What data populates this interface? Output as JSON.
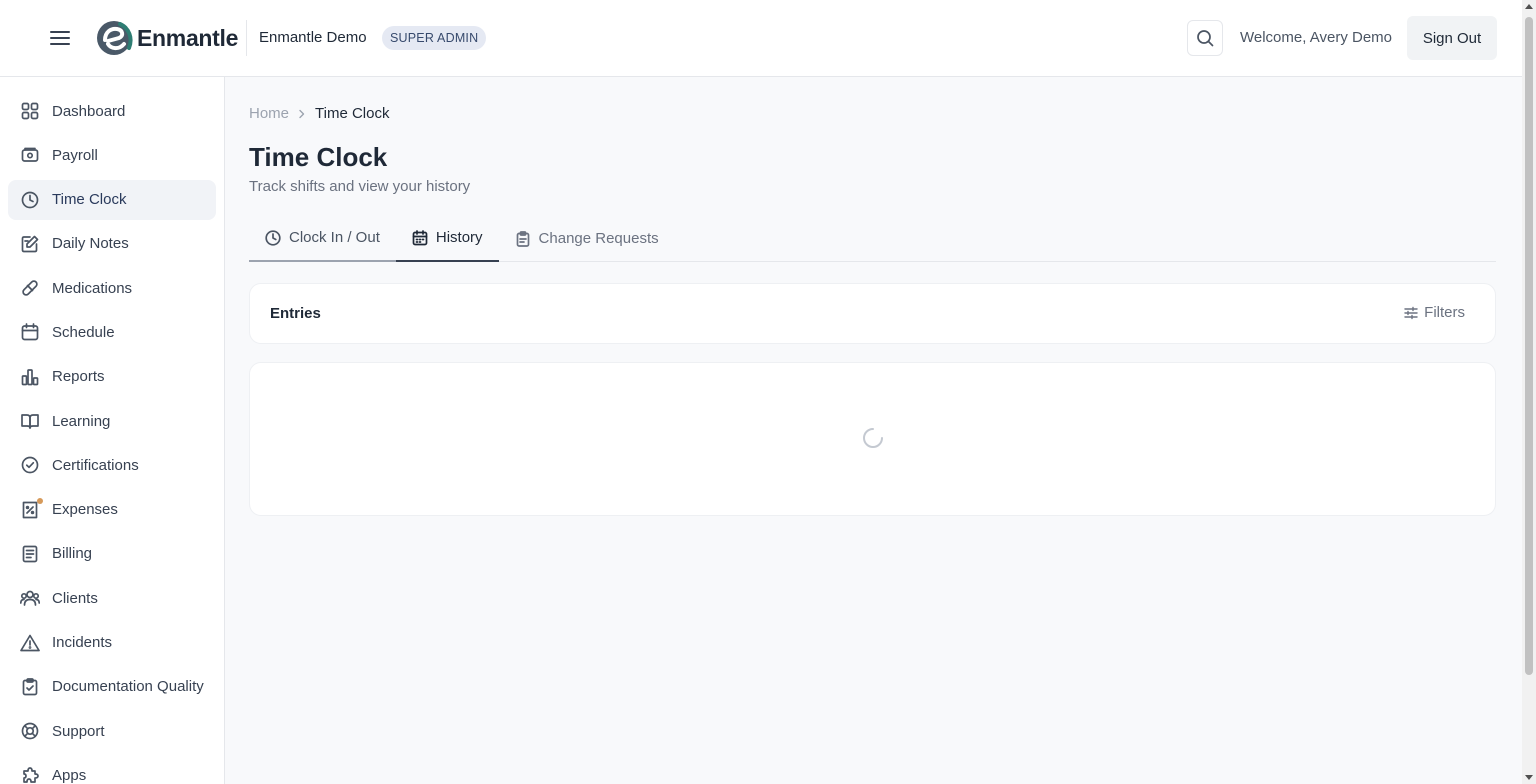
{
  "header": {
    "logo_text": "Enmantle",
    "org_name": "Enmantle Demo",
    "role_badge": "SUPER ADMIN",
    "welcome": "Welcome, Avery Demo",
    "sign_out_label": "Sign Out"
  },
  "sidebar": {
    "items": [
      {
        "label": "Dashboard",
        "icon": "grid-icon"
      },
      {
        "label": "Payroll",
        "icon": "wallet-icon"
      },
      {
        "label": "Time Clock",
        "icon": "clock-icon",
        "active": true
      },
      {
        "label": "Daily Notes",
        "icon": "edit-note-icon"
      },
      {
        "label": "Medications",
        "icon": "pill-icon"
      },
      {
        "label": "Schedule",
        "icon": "calendar-icon"
      },
      {
        "label": "Reports",
        "icon": "bar-chart-icon"
      },
      {
        "label": "Learning",
        "icon": "book-icon"
      },
      {
        "label": "Certifications",
        "icon": "badge-check-icon"
      },
      {
        "label": "Expenses",
        "icon": "receipt-icon"
      },
      {
        "label": "Billing",
        "icon": "document-icon"
      },
      {
        "label": "Clients",
        "icon": "users-icon"
      },
      {
        "label": "Incidents",
        "icon": "alert-triangle-icon"
      },
      {
        "label": "Documentation Quality",
        "icon": "clipboard-check-icon"
      },
      {
        "label": "Support",
        "icon": "life-buoy-icon"
      },
      {
        "label": "Apps",
        "icon": "puzzle-icon"
      }
    ]
  },
  "breadcrumb": {
    "home": "Home",
    "current": "Time Clock"
  },
  "page": {
    "title": "Time Clock",
    "subtitle": "Track shifts and view your history"
  },
  "tabs": [
    {
      "label": "Clock In / Out",
      "icon": "clock-icon"
    },
    {
      "label": "History",
      "icon": "calendar-icon",
      "active": true
    },
    {
      "label": "Change Requests",
      "icon": "clipboard-icon"
    }
  ],
  "entries": {
    "title": "Entries",
    "filters_label": "Filters"
  },
  "colors": {
    "accent_teal": "#2e7d73",
    "text_dark": "#1f2937",
    "notification_dot": "#d69a5a"
  }
}
